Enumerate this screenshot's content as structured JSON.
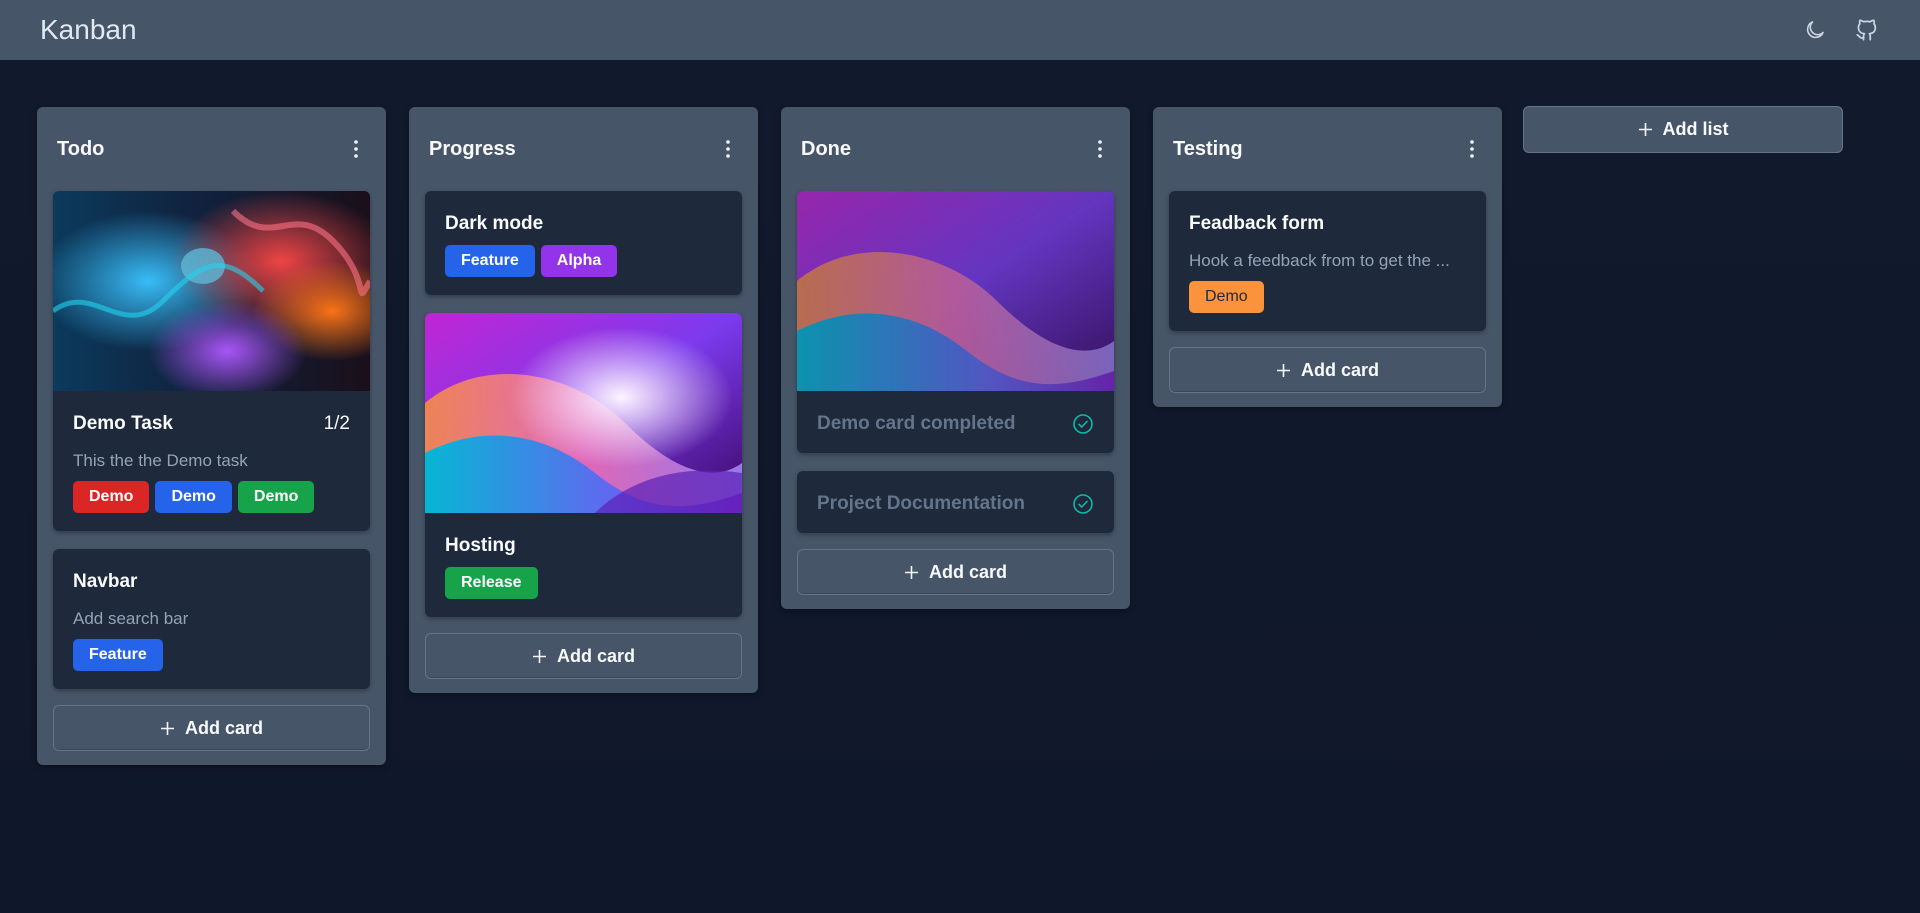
{
  "app": {
    "title": "Kanban"
  },
  "nav": {
    "icons": [
      "moon-icon",
      "github-icon"
    ]
  },
  "colors": {
    "navbar": "#475569",
    "board": "#111827",
    "list": "#475569",
    "card": "#1e293b",
    "red": "#dc2626",
    "blue": "#2563eb",
    "green": "#16a34a",
    "purple": "#9333ea",
    "orange": "#fb923c",
    "teal": "#14b8a6"
  },
  "add_card_label": "Add card",
  "add_list_label": "Add list",
  "lists": [
    {
      "title": "Todo",
      "cards": [
        {
          "cover": "ink-smoke-image",
          "title": "Demo Task",
          "count": "1/2",
          "description": "This the the Demo task",
          "tags": [
            {
              "label": "Demo",
              "color": "#dc2626"
            },
            {
              "label": "Demo",
              "color": "#2563eb"
            },
            {
              "label": "Demo",
              "color": "#16a34a"
            }
          ]
        },
        {
          "title": "Navbar",
          "description": "Add search bar",
          "tags": [
            {
              "label": "Feature",
              "color": "#2563eb"
            }
          ]
        }
      ]
    },
    {
      "title": "Progress",
      "cards": [
        {
          "title": "Dark mode",
          "tags": [
            {
              "label": "Feature",
              "color": "#2563eb"
            },
            {
              "label": "Alpha",
              "color": "#9333ea"
            }
          ]
        },
        {
          "cover": "purple-waves-image",
          "title": "Hosting",
          "tags": [
            {
              "label": "Release",
              "color": "#16a34a"
            }
          ]
        }
      ]
    },
    {
      "title": "Done",
      "cards": [
        {
          "cover": "purple-waves-image",
          "title": "Demo card completed",
          "completed": true
        },
        {
          "title": "Project Documentation",
          "completed": true
        }
      ]
    },
    {
      "title": "Testing",
      "cards": [
        {
          "title": "Feadback form",
          "description": "Hook a feedback from to get the ...",
          "tags": [
            {
              "label": "Demo",
              "color": "#fb923c"
            }
          ]
        }
      ]
    }
  ]
}
